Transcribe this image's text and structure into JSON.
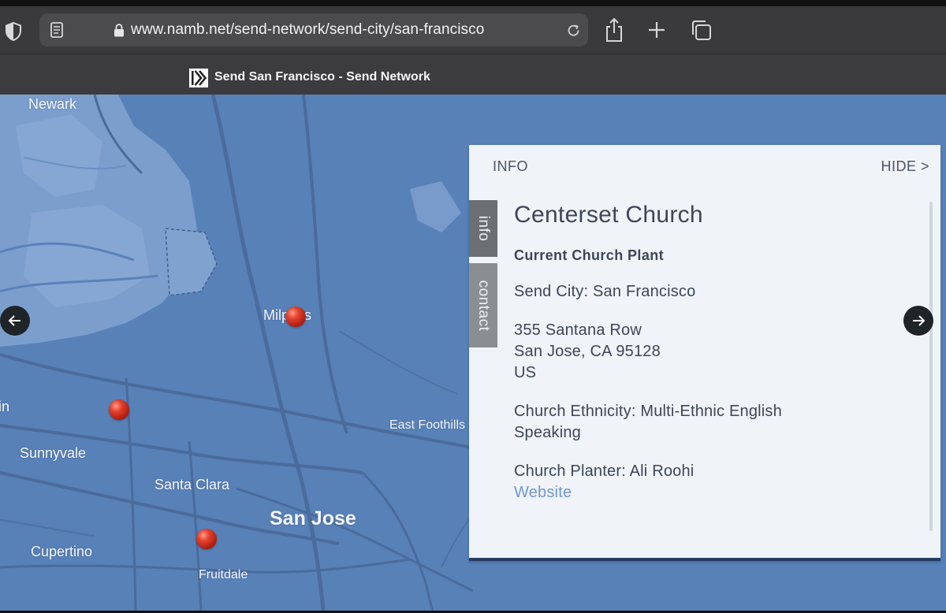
{
  "browser": {
    "url": "www.namb.net/send-network/send-city/san-francisco",
    "tab_title": "Send San Francisco - Send Network"
  },
  "map": {
    "places": [
      {
        "id": "newark",
        "label": "Newark"
      },
      {
        "id": "milpitas",
        "label": "Milpitas"
      },
      {
        "id": "sunnyvale",
        "label": "Sunnyvale"
      },
      {
        "id": "santa-clara",
        "label": "Santa Clara"
      },
      {
        "id": "san-jose",
        "label": "San Jose"
      },
      {
        "id": "east-foothills",
        "label": "East Foothills"
      },
      {
        "id": "cupertino",
        "label": "Cupertino"
      },
      {
        "id": "fruitdale",
        "label": "Fruitdale"
      },
      {
        "id": "partial-left",
        "label": "in"
      }
    ],
    "colors": {
      "water": "#5881b8",
      "land": "#7c9fcd",
      "road": "#4a6b9b",
      "pin": "#c9311e"
    }
  },
  "panel": {
    "header": "INFO",
    "hide_label": "HIDE >",
    "tabs": {
      "info": "info",
      "contact": "contact"
    },
    "church_name": "Centerset Church",
    "status": "Current Church Plant",
    "send_city": "Send City: San Francisco",
    "address": {
      "line1": "355 Santana Row",
      "line2": "San Jose, CA 95128",
      "country": "US"
    },
    "ethnicity_line1": "Church Ethnicity: Multi-Ethnic English",
    "ethnicity_line2": "Speaking",
    "planter": "Church Planter: Ali Roohi",
    "website_label": "Website"
  },
  "icons": [
    "shield-icon",
    "reader-icon",
    "lock-icon",
    "reload-icon",
    "share-icon",
    "plus-icon",
    "tabs-icon",
    "arrow-left-icon",
    "arrow-right-icon",
    "map-pin-icon"
  ]
}
